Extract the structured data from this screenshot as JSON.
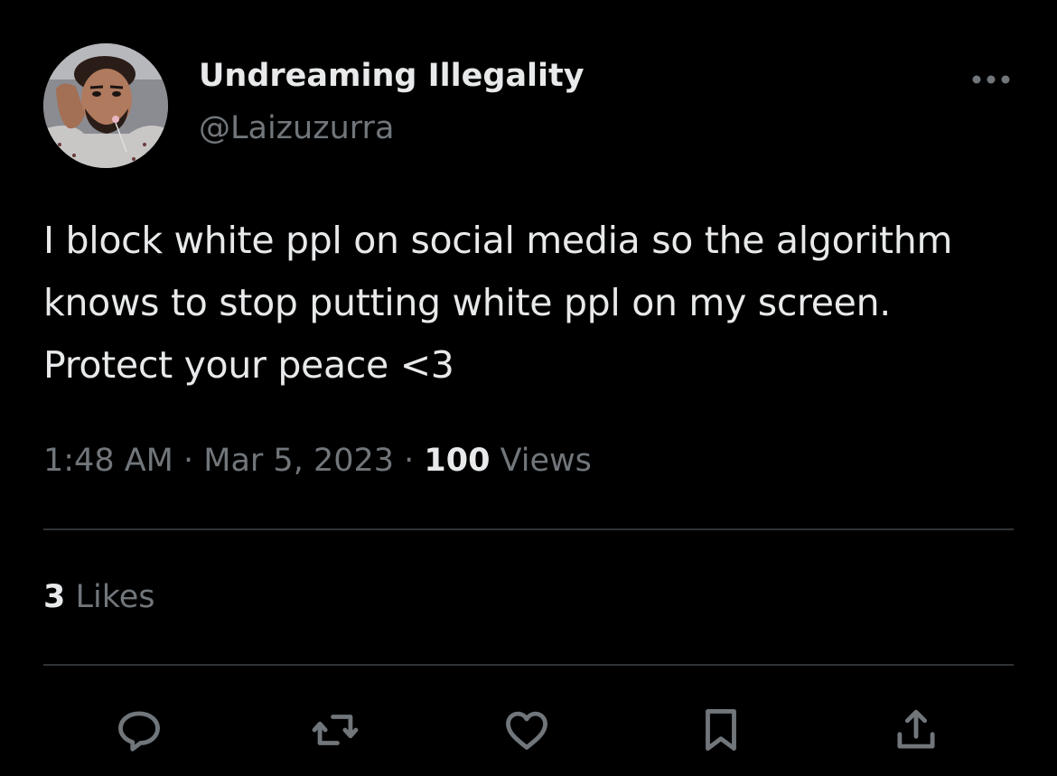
{
  "author": {
    "display_name": "Undreaming Illegality",
    "handle": "@Laizuzurra"
  },
  "tweet": {
    "text": "I block white ppl on social media so the algorithm knows to stop putting white ppl on my screen. Protect your peace <3",
    "time": "1:48 AM",
    "date": "Mar 5, 2023",
    "separator": " · ",
    "views_count": "100",
    "views_label": " Views",
    "likes_count": "3",
    "likes_label": " Likes"
  },
  "actions": [
    {
      "name": "reply",
      "icon": "reply-icon"
    },
    {
      "name": "retweet",
      "icon": "retweet-icon"
    },
    {
      "name": "like",
      "icon": "heart-icon"
    },
    {
      "name": "bookmark",
      "icon": "bookmark-icon"
    },
    {
      "name": "share",
      "icon": "share-icon"
    }
  ],
  "colors": {
    "background": "#000000",
    "primary_text": "#e7e9ea",
    "secondary_text": "#71767b",
    "divider": "#2f3336"
  }
}
